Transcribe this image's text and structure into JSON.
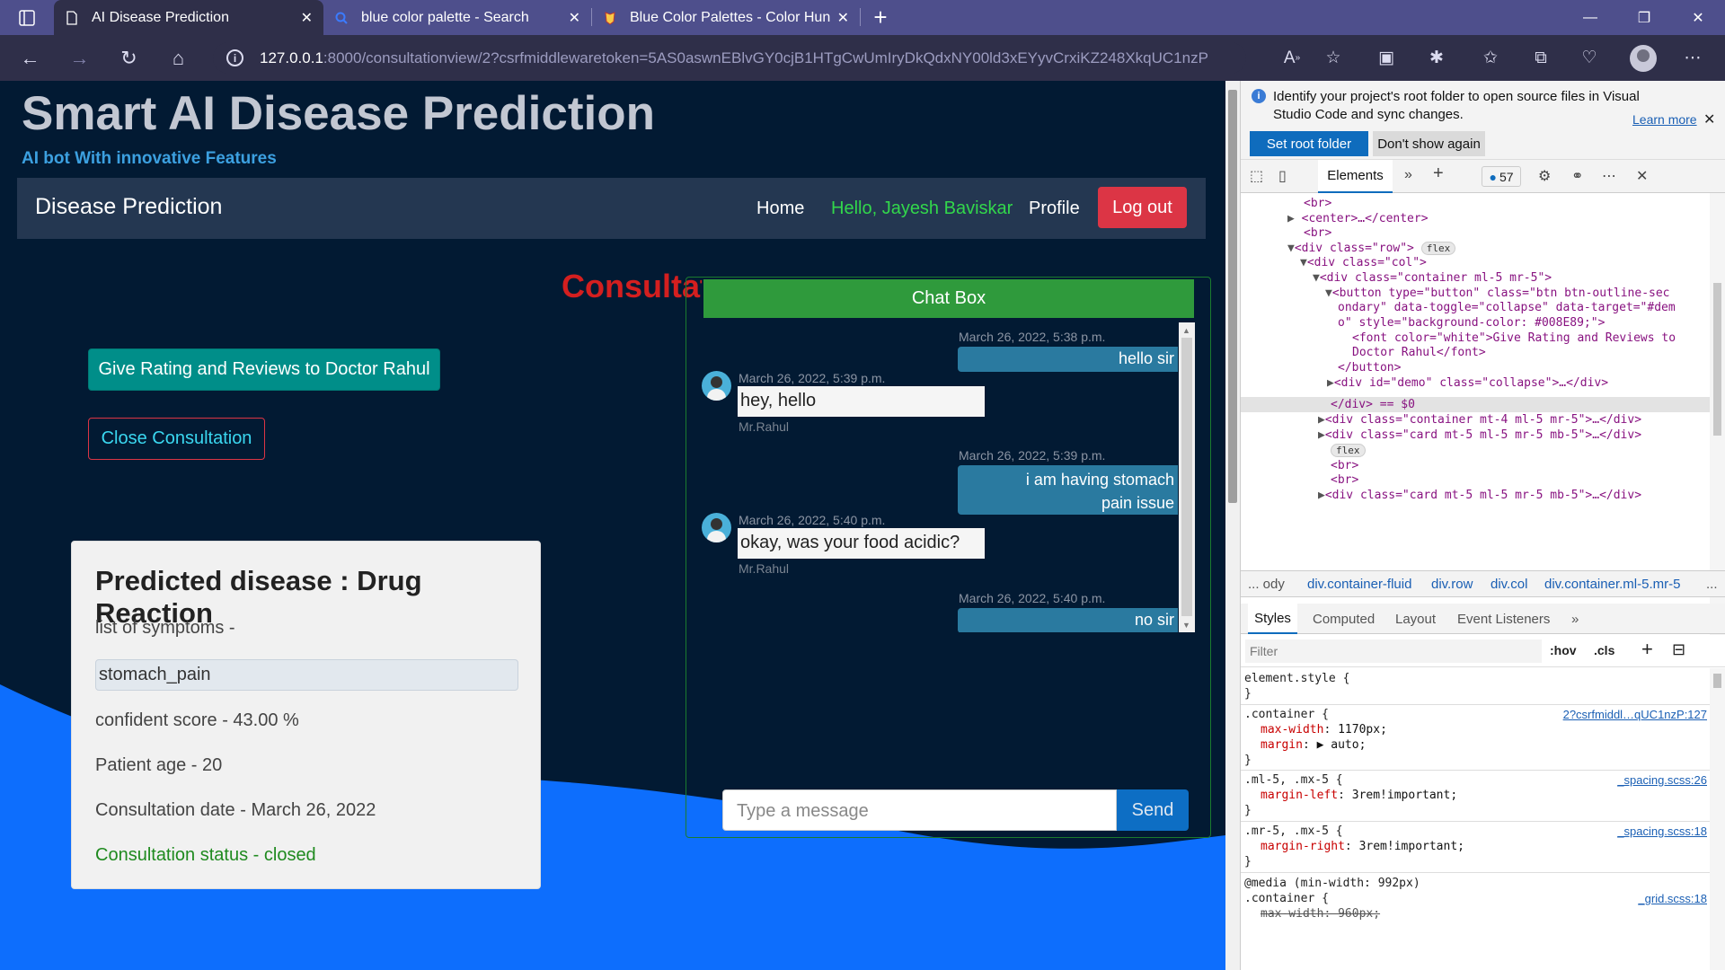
{
  "browser": {
    "tabs": [
      {
        "title": "AI Disease Prediction",
        "active": true
      },
      {
        "title": "blue color palette - Search",
        "active": false
      },
      {
        "title": "Blue Color Palettes - Color Hunt",
        "active": false
      }
    ],
    "url_host": "127.0.0.1",
    "url_rest": ":8000/consultationview/2?csrfmiddlewaretoken=5AS0aswnEBlvGY0cjB1HTgCwUmIryDkQdxNY00ld3xEYyvCrxiKZ248XkqUC1nzP"
  },
  "site": {
    "title": "Smart AI Disease Prediction",
    "subtitle": "AI bot With innovative Features",
    "navbar": {
      "brand": "Disease Prediction",
      "home": "Home",
      "hello": "Hello, Jayesh Baviskar",
      "profile": "Profile",
      "logout": "Log out"
    },
    "consultation_heading": "Consultation",
    "rate_button": "Give Rating and Reviews to Doctor Rahul",
    "close_button": "Close Consultation",
    "card": {
      "title": "Predicted disease : Drug Reaction",
      "symptoms_label": "list of symptoms -",
      "symptom": "stomach_pain",
      "score": "confident score - 43.00 %",
      "age": "Patient age - 20",
      "date": "Consultation date - March 26, 2022",
      "status": "Consultation status - closed"
    },
    "chat": {
      "header": "Chat Box",
      "messages": [
        {
          "dir": "out",
          "time": "March 26, 2022, 5:38 p.m.",
          "text": "hello sir"
        },
        {
          "dir": "in",
          "time": "March 26, 2022, 5:39 p.m.",
          "text": "hey, hello",
          "name": "Mr.Rahul"
        },
        {
          "dir": "out",
          "time": "March 26, 2022, 5:39 p.m.",
          "text": "i am having stomach pain issue"
        },
        {
          "dir": "in",
          "time": "March 26, 2022, 5:40 p.m.",
          "text": "okay, was your food acidic?",
          "name": "Mr.Rahul"
        },
        {
          "dir": "out",
          "time": "March 26, 2022, 5:40 p.m.",
          "text": "no sir"
        }
      ],
      "placeholder": "Type a message",
      "send": "Send"
    }
  },
  "devtools": {
    "info_text": "Identify your project's root folder to open source files in Visual Studio Code and sync changes.",
    "learn_more": "Learn more",
    "set_root": "Set root folder",
    "dont_show": "Don't show again",
    "tab_elements": "Elements",
    "issues_count": "57",
    "crumbs": [
      "... ody",
      "div.container-fluid",
      "div.row",
      "div.col",
      "div.container.ml-5.mr-5",
      "..."
    ],
    "subtabs": [
      "Styles",
      "Computed",
      "Layout",
      "Event Listeners"
    ],
    "filter_placeholder": "Filter",
    "hov": ":hov",
    "cls": ".cls",
    "dom_lines": [
      "<br>",
      "<center>…</center>",
      "<br>",
      "<div class=\"row\">",
      "<div class=\"col\">",
      "<div class=\"container ml-5 mr-5\">",
      "<button type=\"button\" class=\"btn btn-outline-sec",
      "ondary\" data-toggle=\"collapse\" data-target=\"#dem",
      "o\" style=\"background-color: #008E89;\">",
      "<font color=\"white\">Give Rating and Reviews to",
      "Doctor Rahul</font>",
      "</button>",
      "<div id=\"demo\" class=\"collapse\">…</div>",
      "</div> == $0",
      "<div class=\"container mt-4 ml-5 mr-5\">…</div>",
      "<div class=\"card mt-5 ml-5 mr-5 mb-5\">…</div>",
      "<br>",
      "<br>",
      "<div class=\"card mt-5 ml-5 mr-5 mb-5\">…</div>"
    ],
    "flex_badge": "flex",
    "styles": {
      "element_style": "element.style {",
      "rule1_sel": ".container {",
      "rule1_src": "2?csrfmiddl…qUC1nzP:127",
      "rule1_p1": "max-width",
      "rule1_v1": "1170px;",
      "rule1_p2": "margin",
      "rule1_v2": "▶ auto;",
      "rule2_sel": ".ml-5, .mx-5 {",
      "rule2_src": "_spacing.scss:26",
      "rule2_p1": "margin-left",
      "rule2_v1": "3rem!important;",
      "rule3_sel": ".mr-5, .mx-5 {",
      "rule3_src": "_spacing.scss:18",
      "rule3_p1": "margin-right",
      "rule3_v1": "3rem!important;",
      "media": "@media (min-width: 992px)",
      "rule4_sel": ".container {",
      "rule4_src": "_grid.scss:18",
      "rule4_p1": "max-width: 960px;",
      "close": "}"
    }
  },
  "colors": {
    "page_bg": "#021a33",
    "wave_blue": "#0d6efd",
    "teal_button": "#008e89",
    "logout_red": "#dc3545",
    "chat_green": "#2f9a3c"
  }
}
